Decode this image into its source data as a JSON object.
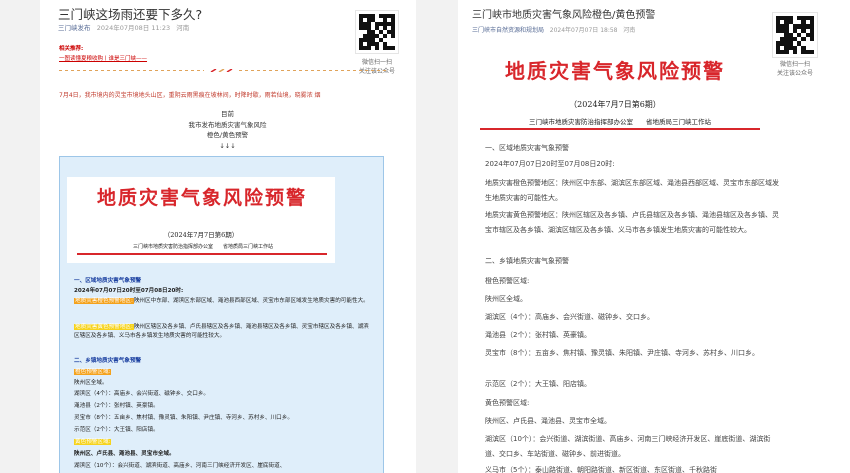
{
  "left": {
    "title": "三门峡这场雨还要下多久?",
    "account": "三门峡发布",
    "datetime": "2024年07月08日 11:23",
    "location": "河南",
    "qr_caption_1": "微信扫一扫",
    "qr_caption_2": "关注该公众号",
    "related_label": "相关推荐:",
    "related_link": "一图读懂夏粮收购丨谁是三门峡——",
    "body_red": "7月4日，我市境内的灵宝市境地头山区，重阴云雨黑痕在坡林间，时降时歇，雨若仙境，晓雾浓 烟",
    "center_lines": [
      "目前",
      "我市发布地质灾害气象风险",
      "橙色/黄色预警",
      "↓↓↓"
    ],
    "inner": {
      "big_title": "地质灾害气象风险预警",
      "issue": "（2024年7月7日第6期）",
      "office": "三门峡市地质灾害防治指挥部办公室　　省地质局三门峡工作站",
      "section1": "一、区域地质灾害气象预警",
      "time": "2024年07月07日20时至07月08日20时:",
      "orange_tag": "地质灾害橙色预警地区:",
      "orange_text": "陕州区中东部、湖滨区东部区域、渑池县西部区域、灵宝市东部区域发生地质灾害的可能性大。",
      "yellow_tag": "地质灾害黄色预警地区:",
      "yellow_text": "陕州区辖区及各乡镇、卢氏县辖区及各乡镇、渑池县辖区及各乡镇、灵宝市辖区及各乡镇、湖滨区辖区及各乡镇、义马市各乡镇发生地质灾害的可能性较大。",
      "section2": "二、乡镇地质灾害气象预警",
      "orange_area_tag": "橙色预警区域:",
      "line_shanzhou": "陕州区全域。",
      "line_hubin": "湖滨区（4个）：高庙乡、会兴街道、磁钟乡、交口乡。",
      "line_mianchi": "渑池县（2个）：张村镇、英豪镇。",
      "line_lingbao": "灵宝市（8个）：五亩乡、焦村镇、豫灵镇、朱阳镇、尹庄镇、寺河乡、苏村乡、川口乡。",
      "line_shifan": "示范区（2个）：大王镇、阳店镇。",
      "yellow_area_tag": "黄色预警区域:",
      "line_y1": "陕州区、卢氏县、渑池县、灵宝市全域。",
      "line_y2": "湖滨区（10个）：会兴街道、湖滨街道、高庙乡、河南三门峡经济开发区、崖底街道、"
    }
  },
  "right": {
    "title": "三门峡市地质灾害气象风险橙色/黄色预警",
    "account": "三门峡市自然资源和规划局",
    "datetime": "2024年07月07日 18:58",
    "location": "河南",
    "qr_caption_1": "微信扫一扫",
    "qr_caption_2": "关注该公众号",
    "big_title": "地质灾害气象风险预警",
    "issue": "（2024年7月7日第6期）",
    "office": "三门峡市地质灾害防治指挥部办公室　　省地质局三门峡工作站",
    "p1": "一、区域地质灾害气象预警",
    "p2": "2024年07月07日20时至07月08日20时:",
    "p3": "地质灾害橙色预警地区：陕州区中东部、湖滨区东部区域、渑池县西部区域、灵宝市东部区域发生地质灾害的可能性大。",
    "p4": "地质灾害黄色预警地区：陕州区辖区及各乡镇、卢氏县辖区及各乡镇、渑池县辖区及各乡镇、灵宝市辖区及各乡镇、湖滨区辖区及各乡镇、义马市各乡镇发生地质灾害的可能性较大。",
    "p5": "二、乡镇地质灾害气象预警",
    "p6": "橙色预警区域:",
    "p7": "陕州区全域。",
    "p8": "湖滨区（4个）：高庙乡、会兴街道、磁钟乡、交口乡。",
    "p9": "渑池县（2个）：张村镇、英豪镇。",
    "p10": "灵宝市（8个）：五亩乡、焦村镇、豫灵镇、朱阳镇、尹庄镇、寺河乡、苏村乡、川口乡。",
    "p11": "示范区（2个）：大王镇、阳店镇。",
    "p12": "黄色预警区域:",
    "p13": "陕州区、卢氏县、渑池县、灵宝市全域。",
    "p14": "湖滨区（10个）：会兴街道、湖滨街道、高庙乡、河南三门峡经济开发区、崖底街道、湖滨街道、交口乡、车站街道、磁钟乡、前进街道。",
    "p15": "义马市（5个）：泰山路街道、朝阳路街道、新区街道、东区街道、千秋路街"
  }
}
